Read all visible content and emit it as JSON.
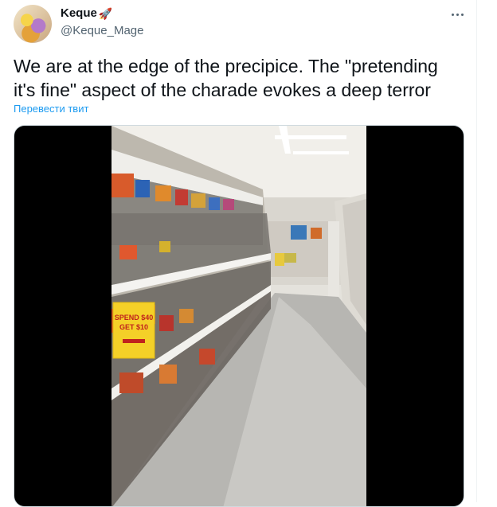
{
  "user": {
    "display_name": "Keque",
    "name_emoji": "🚀",
    "handle": "@Keque_Mage"
  },
  "tweet": {
    "text": "We are at the edge of the precipice. The \"pretending it's fine\" aspect of the charade evokes a deep terror",
    "translate_label": "Перевести твит"
  },
  "media": {
    "sign_text": [
      "SPEND $40",
      "GET $10"
    ]
  },
  "icons": {
    "more": "more-horizontal-icon"
  },
  "colors": {
    "link": "#1d9bf0",
    "secondary_text": "#536471"
  }
}
